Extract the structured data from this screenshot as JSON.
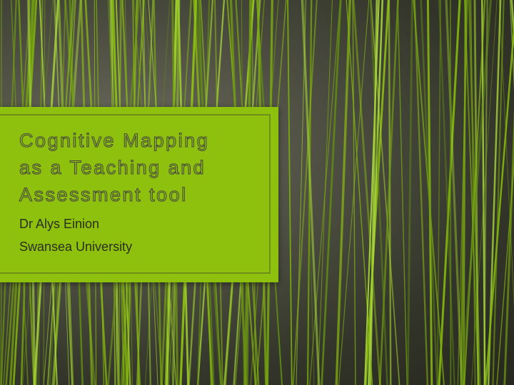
{
  "slide": {
    "title_lines": [
      "Cognitive Mapping",
      "as a Teaching and",
      "Assessment tool"
    ],
    "subtitle_lines": [
      "Dr Alys Einion",
      "Swansea University"
    ]
  },
  "colors": {
    "accent": "#8dc10e",
    "background": "#2e2f24",
    "title_outline": "#4a4a3e",
    "subtitle_text": "#2a2e1c"
  }
}
